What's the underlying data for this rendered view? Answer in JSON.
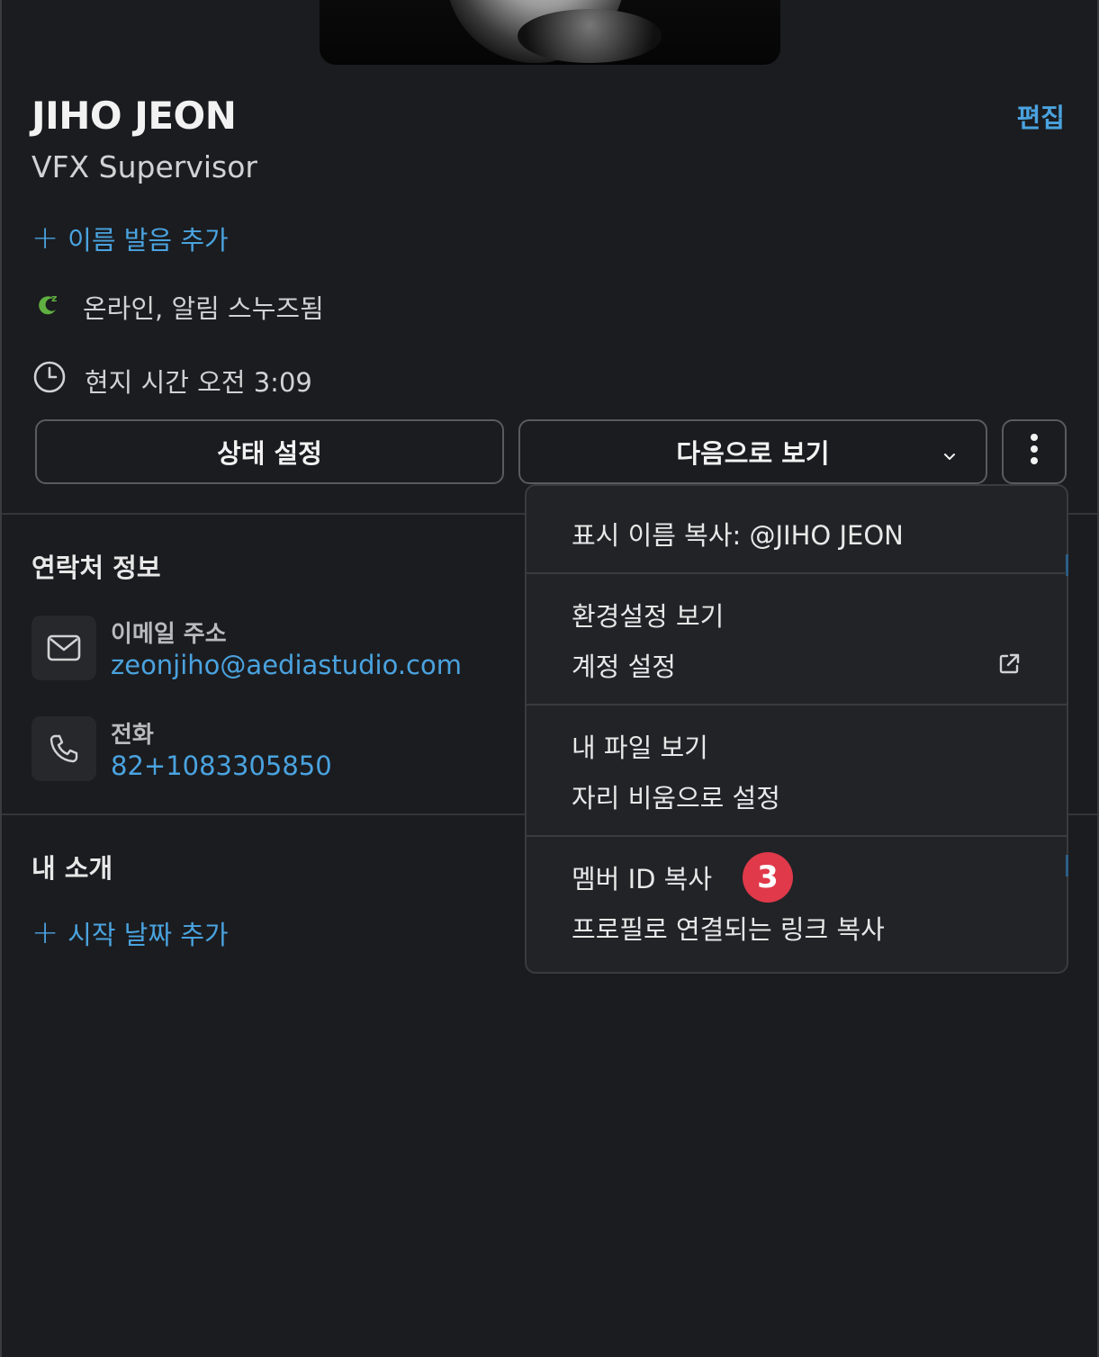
{
  "profile": {
    "name": "JIHO JEON",
    "title": "VFX Supervisor",
    "edit_label": "편집",
    "add_pronunciation": "이름 발음 추가",
    "status_text": "온라인, 알림 스누즈됨",
    "local_time": "현지 시간 오전 3:09"
  },
  "buttons": {
    "set_status": "상태 설정",
    "view_as": "다음으로 보기"
  },
  "contact": {
    "section_title": "연락처 정보",
    "email_label": "이메일 주소",
    "email_value": "zeonjiho@aediastudio.com",
    "phone_label": "전화",
    "phone_value": "82+1083305850"
  },
  "about": {
    "section_title": "내 소개",
    "add_start_date": "시작 날짜 추가"
  },
  "menu": {
    "copy_display_name": "표시 이름 복사: @JIHO JEON",
    "view_preferences": "환경설정 보기",
    "account_settings": "계정 설정",
    "view_my_files": "내 파일 보기",
    "set_away": "자리 비움으로 설정",
    "copy_member_id": "멤버 ID 복사",
    "copy_profile_link": "프로필로 연결되는 링크 복사",
    "badge_number": "3"
  },
  "colors": {
    "background": "#1b1c20",
    "link": "#4aa3df",
    "badge": "#e0394a",
    "snooze_icon": "#5fb040"
  },
  "icons": [
    "plus-icon",
    "snooze-icon",
    "clock-icon",
    "chevron-down-icon",
    "more-vertical-icon",
    "mail-icon",
    "phone-icon",
    "external-link-icon"
  ]
}
